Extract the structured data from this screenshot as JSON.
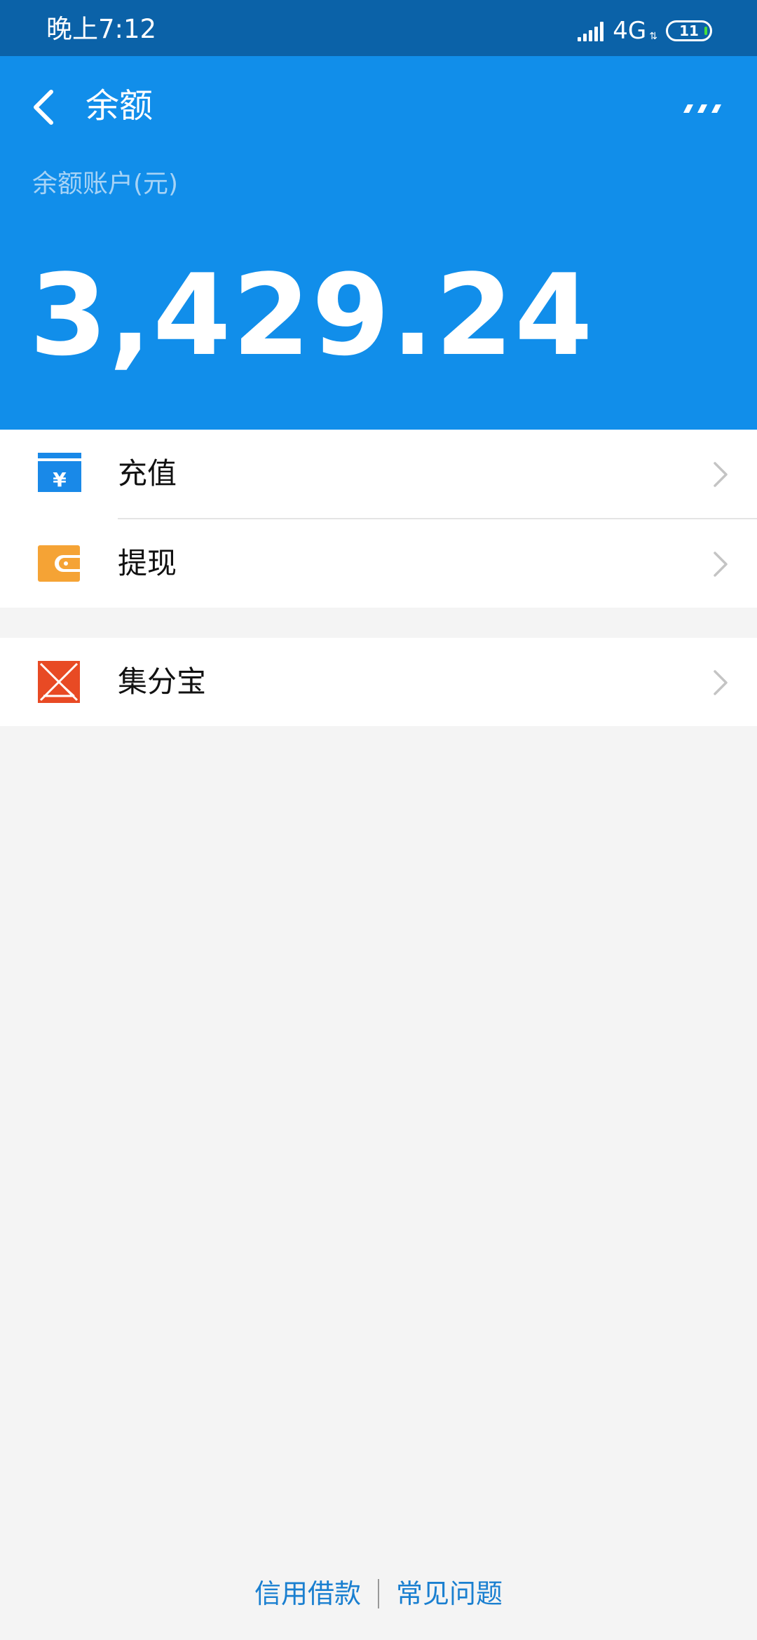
{
  "status_bar": {
    "time": "晚上7:12",
    "network": "4G",
    "battery": "11"
  },
  "header": {
    "title": "余额",
    "account_label": "余额账户(元)",
    "balance": "3,429.24",
    "back_icon": "chevron-left-icon",
    "more_icon": "more-dots-icon"
  },
  "menu": {
    "items": [
      {
        "label": "充值",
        "icon": "recharge-yuan-icon",
        "color": "#1989e8"
      },
      {
        "label": "提现",
        "icon": "wallet-icon",
        "color": "#f5a335"
      },
      {
        "label": "集分宝",
        "icon": "jifenbao-icon",
        "color": "#e84a24"
      }
    ]
  },
  "footer": {
    "links": [
      "信用借款",
      "常见问题"
    ]
  }
}
